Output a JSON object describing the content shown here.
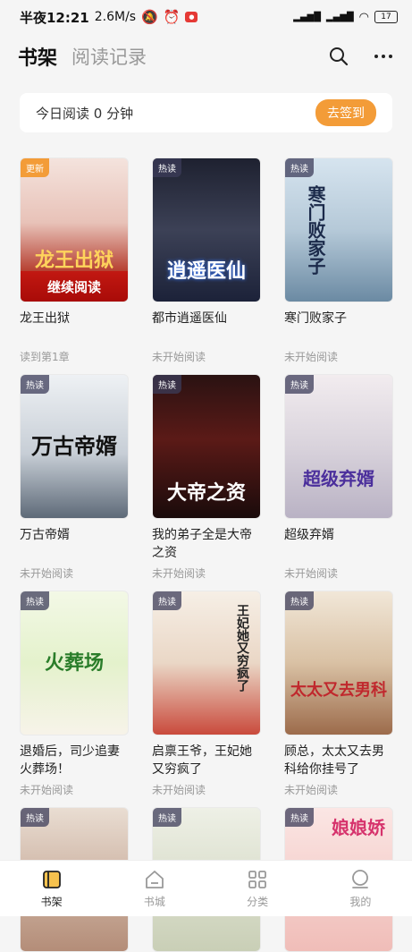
{
  "status": {
    "time": "半夜12:21",
    "speed": "2.6M/s",
    "battery": "17"
  },
  "header": {
    "tab_bookshelf": "书架",
    "tab_history": "阅读记录"
  },
  "checkin": {
    "text": "今日阅读 0 分钟",
    "button": "去签到"
  },
  "books": [
    {
      "title": "龙王出狱",
      "progress": "读到第1章",
      "tag": "更新",
      "cover_text": "龙王出狱",
      "continue": "继续阅读"
    },
    {
      "title": "都市逍遥医仙",
      "progress": "未开始阅读",
      "tag": "热读",
      "cover_text": "逍遥医仙"
    },
    {
      "title": "寒门败家子",
      "progress": "未开始阅读",
      "tag": "热读",
      "cover_text": "寒门败家子"
    },
    {
      "title": "万古帝婿",
      "progress": "未开始阅读",
      "tag": "热读",
      "cover_text": "万古帝婿"
    },
    {
      "title": "我的弟子全是大帝之资",
      "progress": "未开始阅读",
      "tag": "热读",
      "cover_text": "大帝之资"
    },
    {
      "title": "超级弃婿",
      "progress": "未开始阅读",
      "tag": "热读",
      "cover_text": "超级弃婿"
    },
    {
      "title": "退婚后，司少追妻火葬场！",
      "progress": "未开始阅读",
      "tag": "热读",
      "cover_text": "火葬场"
    },
    {
      "title": "启禀王爷，王妃她又穷疯了",
      "progress": "未开始阅读",
      "tag": "热读",
      "cover_text": "王妃她又穷疯了"
    },
    {
      "title": "顾总，太太又去男科给你挂号了",
      "progress": "未开始阅读",
      "tag": "热读",
      "cover_text": "太太又去男科"
    },
    {
      "title": "",
      "progress": "",
      "tag": "热读",
      "cover_text": ""
    },
    {
      "title": "",
      "progress": "",
      "tag": "热读",
      "cover_text": ""
    },
    {
      "title": "",
      "progress": "",
      "tag": "热读",
      "cover_text": "娘娘娇"
    }
  ],
  "nav": {
    "bookshelf": "书架",
    "store": "书城",
    "category": "分类",
    "mine": "我的"
  }
}
